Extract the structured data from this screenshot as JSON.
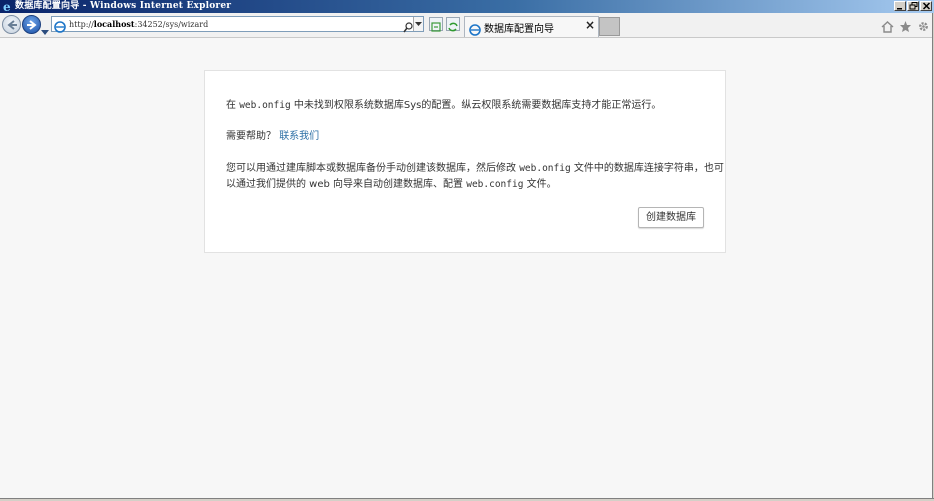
{
  "window": {
    "title": "数据库配置向导 - Windows Internet Explorer"
  },
  "browser": {
    "url_prefix": "http://",
    "url_host": "localhost",
    "url_rest": ":34252/sys/wizard",
    "tab_title": "数据库配置向导",
    "tab_close": "×"
  },
  "content": {
    "p1_a": "在 ",
    "p1_code": "web.onfig",
    "p1_b": " 中未找到权限系统数据库Sys的配置。纵云权限系统需要数据库支持才能正常运行。",
    "help_prefix": "需要帮助？",
    "help_link": "联系我们",
    "p3_a": "您可以用通过建库脚本或数据库备份手动创建该数据库，然后修改 ",
    "p3_code": "web.onfig",
    "p3_b": " 文件中的数据库连接字符串，也可",
    "p4_a": "以通过我们提供的 web 向导来自动创建数据库、配置 ",
    "p4_code": "web.config",
    "p4_b": " 文件。",
    "create_button": "创建数据库"
  },
  "colors": {
    "link": "#2c6fa5",
    "page_background": "#f7f7f7"
  },
  "icons": [
    "ie-logo-icon",
    "minimize-icon",
    "restore-icon",
    "close-icon",
    "back-arrow-icon",
    "forward-arrow-icon",
    "recent-pages-icon",
    "page-icon",
    "search-icon",
    "compatibility-view-icon",
    "refresh-icon",
    "home-icon",
    "favorites-star-icon",
    "tools-gear-icon"
  ]
}
